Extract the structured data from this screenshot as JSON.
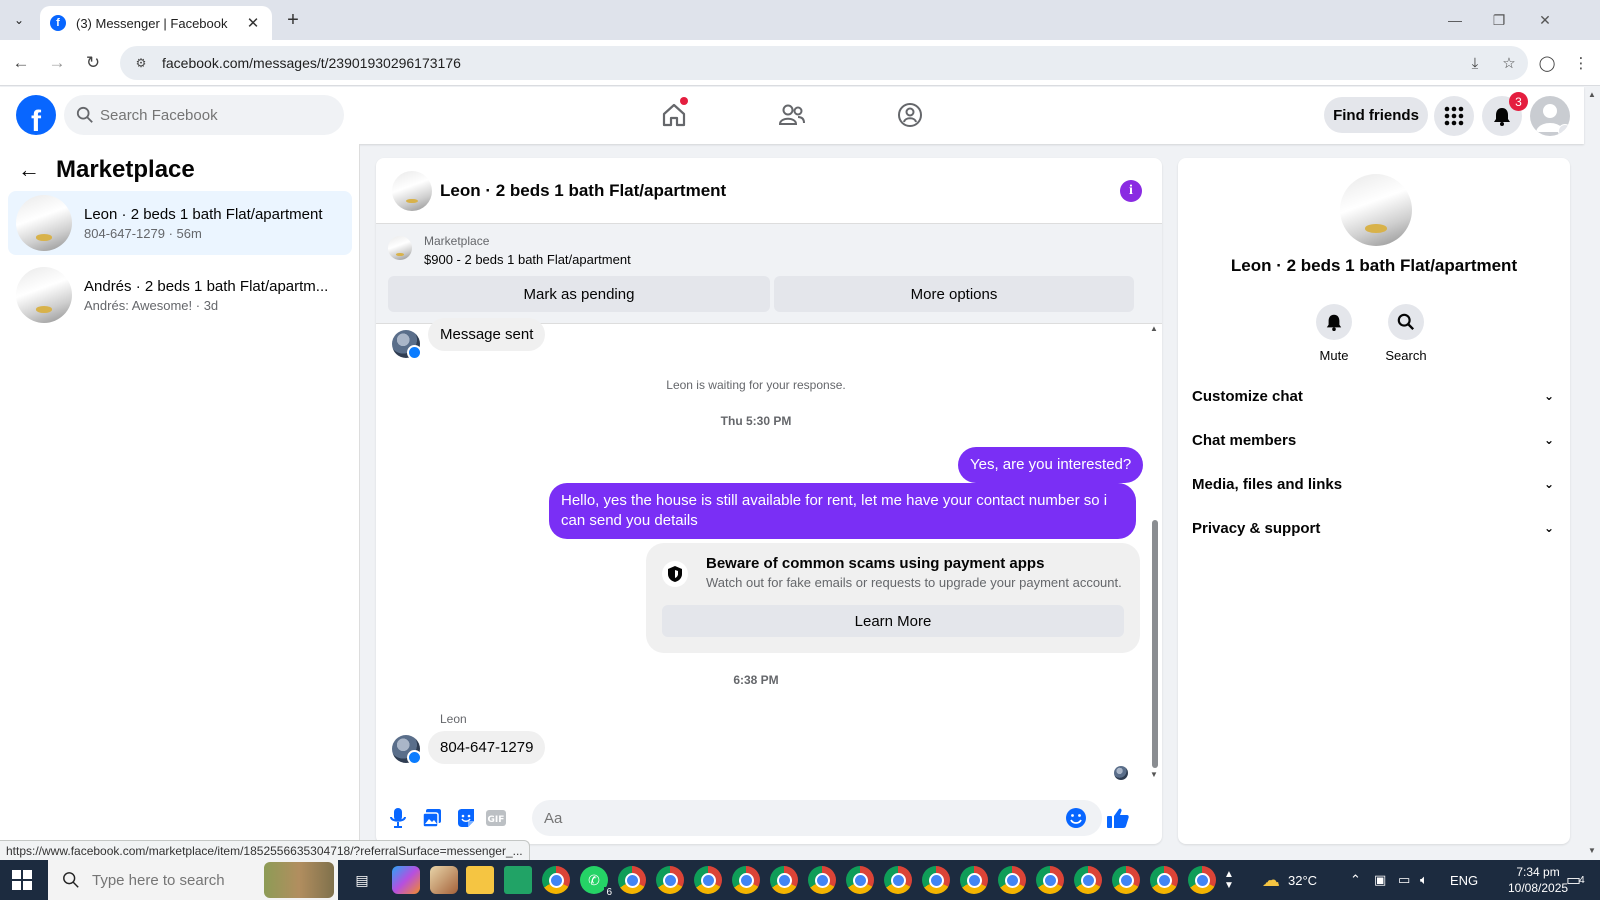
{
  "browser": {
    "tab_title": "(3) Messenger | Facebook",
    "tab_favicon": "facebook-favicon",
    "url": "facebook.com/messages/t/23901930296173176",
    "status_url": "https://www.facebook.com/marketplace/item/1852556635304718/?referralSurface=messenger_..."
  },
  "fb_nav": {
    "search_placeholder": "Search Facebook",
    "find_friends": "Find friends",
    "notifications_count": "3"
  },
  "sidebar": {
    "title": "Marketplace",
    "conversations": [
      {
        "name": "Leon · 2 beds 1 bath Flat/apartment",
        "preview": "804-647-1279 · 56m",
        "active": true
      },
      {
        "name": "Andrés · 2 beds 1 bath Flat/apartm...",
        "preview": "Andrés: Awesome! · 3d",
        "active": false
      }
    ]
  },
  "chat": {
    "title": "Leon · 2 beds 1 bath Flat/apartment",
    "listing": {
      "label": "Marketplace",
      "price_line": "$900 - 2 beds 1 bath Flat/apartment",
      "mark_pending": "Mark as pending",
      "more_options": "More options"
    },
    "messages": {
      "sent_notice": "Message sent",
      "waiting": "Leon is waiting for your response.",
      "time1": "Thu 5:30 PM",
      "out1": "Yes, are you interested?",
      "out2": "Hello, yes the house is still available for rent, let me have your contact number so i can send you details",
      "time2": "6:38 PM",
      "sender": "Leon",
      "in1": "804-647-1279"
    },
    "scam": {
      "title": "Beware of common scams using payment apps",
      "desc": "Watch out for fake emails or requests to upgrade your payment account.",
      "button": "Learn More"
    },
    "composer_placeholder": "Aa"
  },
  "info_panel": {
    "name": "Leon · 2 beds 1 bath Flat/apartment",
    "actions": [
      {
        "label": "Mute",
        "icon": "bell-icon"
      },
      {
        "label": "Search",
        "icon": "search-icon"
      }
    ],
    "sections": [
      "Customize chat",
      "Chat members",
      "Media, files and links",
      "Privacy & support"
    ]
  },
  "taskbar": {
    "search_placeholder": "Type here to search",
    "whatsapp_badge": "6",
    "weather": "32°C",
    "language": "ENG",
    "time": "7:34 pm",
    "date": "10/08/2025",
    "notif_count": "4"
  },
  "colors": {
    "fb_blue": "#0866ff",
    "outgoing_bubble": "#7a2ff5",
    "active_conv": "#ebf5ff",
    "badge_red": "#e41e3f"
  }
}
